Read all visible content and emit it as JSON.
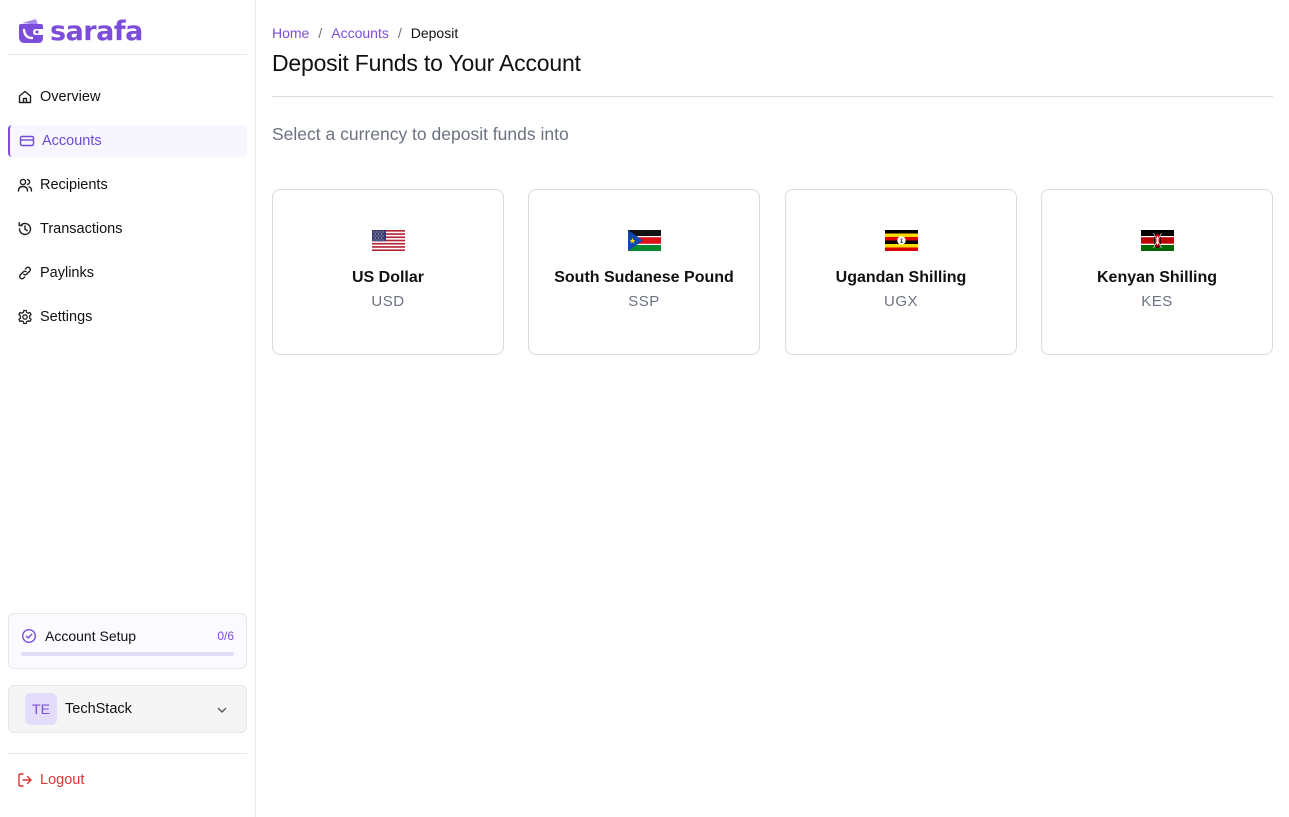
{
  "brand": {
    "name": "sarafa",
    "color": "#7c4ddb"
  },
  "sidebar": {
    "items": [
      {
        "label": "Overview",
        "icon": "home-icon"
      },
      {
        "label": "Accounts",
        "icon": "card-icon",
        "active": true
      },
      {
        "label": "Recipients",
        "icon": "users-icon"
      },
      {
        "label": "Transactions",
        "icon": "history-icon"
      },
      {
        "label": "Paylinks",
        "icon": "link-icon"
      },
      {
        "label": "Settings",
        "icon": "gear-icon"
      }
    ],
    "setup": {
      "label": "Account Setup",
      "count": "0/6",
      "progress": 0
    },
    "org": {
      "initials": "TE",
      "name": "TechStack"
    },
    "logout": "Logout"
  },
  "main": {
    "breadcrumb": {
      "home": "Home",
      "accounts": "Accounts",
      "current": "Deposit",
      "separator": "/"
    },
    "title": "Deposit Funds to Your Account",
    "subtitle": "Select a currency to deposit funds into",
    "currencies": [
      {
        "name": "US Dollar",
        "code": "USD",
        "flag": "us-flag"
      },
      {
        "name": "South Sudanese Pound",
        "code": "SSP",
        "flag": "south-sudan-flag"
      },
      {
        "name": "Ugandan Shilling",
        "code": "UGX",
        "flag": "uganda-flag"
      },
      {
        "name": "Kenyan Shilling",
        "code": "KES",
        "flag": "kenya-flag"
      }
    ]
  }
}
